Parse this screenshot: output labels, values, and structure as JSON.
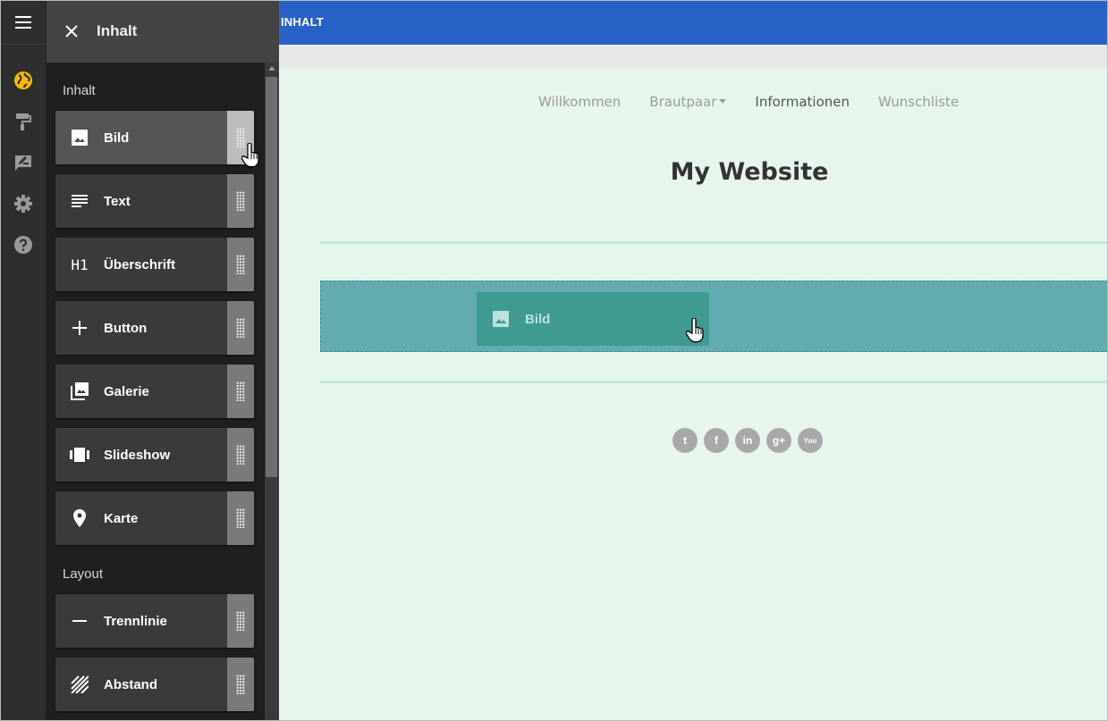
{
  "panel": {
    "title": "Inhalt",
    "sections": [
      {
        "label": "Inhalt",
        "items": [
          {
            "label": "Bild",
            "icon": "image-icon"
          },
          {
            "label": "Text",
            "icon": "text-lines-icon"
          },
          {
            "label": "Überschrift",
            "icon": "heading-h1-icon",
            "icon_text": "H1"
          },
          {
            "label": "Button",
            "icon": "plus-icon"
          },
          {
            "label": "Galerie",
            "icon": "gallery-icon"
          },
          {
            "label": "Slideshow",
            "icon": "slideshow-icon"
          },
          {
            "label": "Karte",
            "icon": "map-pin-icon"
          }
        ]
      },
      {
        "label": "Layout",
        "items": [
          {
            "label": "Trennlinie",
            "icon": "divider-icon"
          },
          {
            "label": "Abstand",
            "icon": "spacer-icon"
          }
        ]
      }
    ]
  },
  "rail": {
    "icons": [
      "menu-icon",
      "globe-icon",
      "paint-roller-icon",
      "edit-post-icon",
      "gear-icon",
      "help-icon"
    ],
    "active_color": "#f5b800"
  },
  "topbar": {
    "title": "INHALT",
    "color": "#2962c6"
  },
  "website": {
    "nav": [
      "Willkommen",
      "Brautpaar",
      "Informationen",
      "Wunschliste"
    ],
    "nav_current": "Informationen",
    "title": "My Website",
    "drag_ghost_label": "Bild",
    "social": [
      {
        "name": "twitter-icon",
        "glyph": "t"
      },
      {
        "name": "facebook-icon",
        "glyph": "f"
      },
      {
        "name": "linkedin-icon",
        "glyph": "in"
      },
      {
        "name": "google-plus-icon",
        "glyph": "g+"
      },
      {
        "name": "youtube-icon",
        "glyph": "You"
      }
    ],
    "background": "#e7f6ec"
  }
}
